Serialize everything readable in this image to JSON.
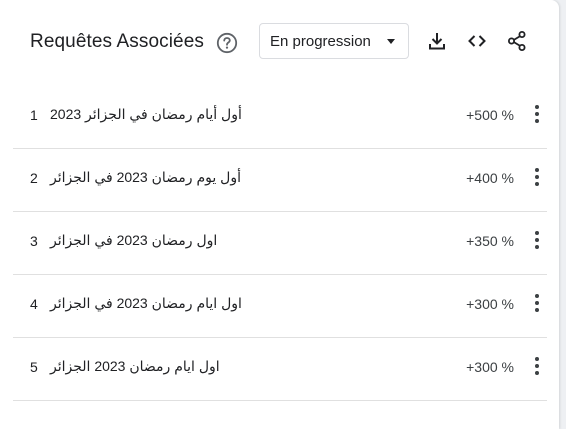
{
  "widget": {
    "title": "Requêtes Associées",
    "filter": {
      "selected": "En progression"
    },
    "icons": {
      "help": "help-circle-icon",
      "download": "download-icon",
      "embed": "code-icon",
      "share": "share-icon",
      "row_menu": "more-vert-icon"
    },
    "rows": [
      {
        "index": "1",
        "query": "أول أيام رمضان في الجزائر 2023",
        "value": "+500 %"
      },
      {
        "index": "2",
        "query": "أول يوم رمضان 2023 في الجزائر",
        "value": "+400 %"
      },
      {
        "index": "3",
        "query": "اول رمضان 2023 في الجزائر",
        "value": "+350 %"
      },
      {
        "index": "4",
        "query": "اول ايام رمضان 2023 في الجزائر",
        "value": "+300 %"
      },
      {
        "index": "5",
        "query": "اول ايام رمضان 2023 الجزائر",
        "value": "+300 %"
      }
    ]
  },
  "colors": {
    "text": "#202124",
    "icon": "#5f6368",
    "divider": "#e0e0e0"
  }
}
